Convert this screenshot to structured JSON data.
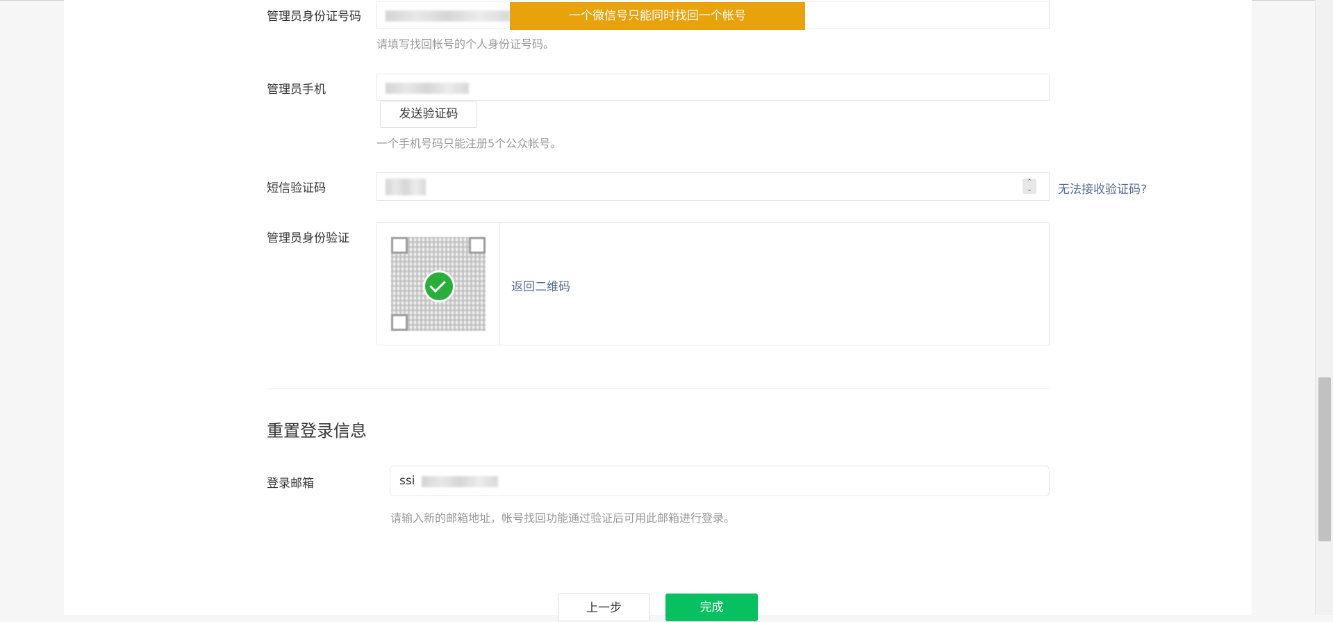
{
  "toast": {
    "text": "一个微信号只能同时找回一个帐号"
  },
  "id_number": {
    "label": "管理员身份证号码",
    "tip": "请填写找回帐号的个人身份证号码。"
  },
  "phone": {
    "label": "管理员手机",
    "send_code_button": "发送验证码",
    "tip": "一个手机号码只能注册5个公众帐号。"
  },
  "sms_code": {
    "label": "短信验证码",
    "spinner_up": "⌃",
    "spinner_down": "⌄",
    "help_link": "无法接收验证码?"
  },
  "identity_verify": {
    "label": "管理员身份验证",
    "back_link": "返回二维码",
    "status": "verified"
  },
  "reset_section": {
    "title": "重置登录信息",
    "email_label": "登录邮箱",
    "email_value": "ssi",
    "email_tip": "请输入新的邮箱地址，帐号找回功能通过验证后可用此邮箱进行登录。"
  },
  "footer": {
    "prev_button": "上一步",
    "done_button": "完成"
  },
  "colors": {
    "toast": "#e8a20c",
    "link": "#576b95",
    "primary_button": "#07c160",
    "check": "#2aae3b"
  }
}
